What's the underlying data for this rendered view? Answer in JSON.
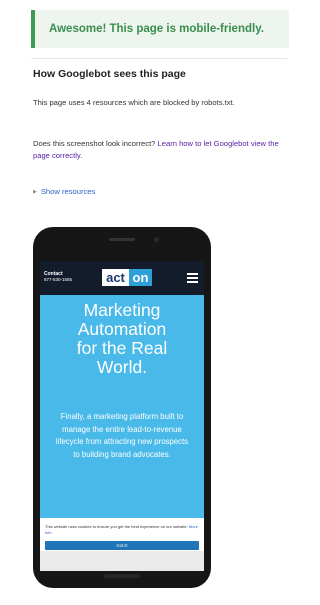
{
  "banner": {
    "message": "Awesome! This page is mobile-friendly."
  },
  "section": {
    "title": "How Googlebot sees this page",
    "blocked_text": "This page uses 4 resources which are blocked by robots.txt.",
    "incorrect_prefix": "Does this screenshot look incorrect?",
    "learn_link": "Learn how to let Googlebot view the page correctly.",
    "show_resources": "Show resources"
  },
  "phone_screen": {
    "contact_label": "Contact",
    "contact_phone": "877-530-1555",
    "logo_left": "act",
    "logo_right": "on",
    "hero_lines": [
      "Marketing",
      "Automation",
      "for the Real",
      "World."
    ],
    "subtext": "Finally, a marketing platform built to manage the entire lead-to-revenue lifecycle from attracting new prospects to building brand advocates.",
    "cookie_text": "This website uses cookies to ensure you get the best experience on our website.",
    "cookie_link": "More info",
    "cookie_button": "Got it!"
  },
  "icons": {
    "expand": "triangle-right-icon",
    "menu": "hamburger-menu-icon"
  },
  "colors": {
    "success": "#3a8e4e",
    "link_visited": "#5a22a8",
    "link": "#2f63c8",
    "hero_bg": "#48b9e8",
    "topbar_bg": "#131c2b"
  }
}
